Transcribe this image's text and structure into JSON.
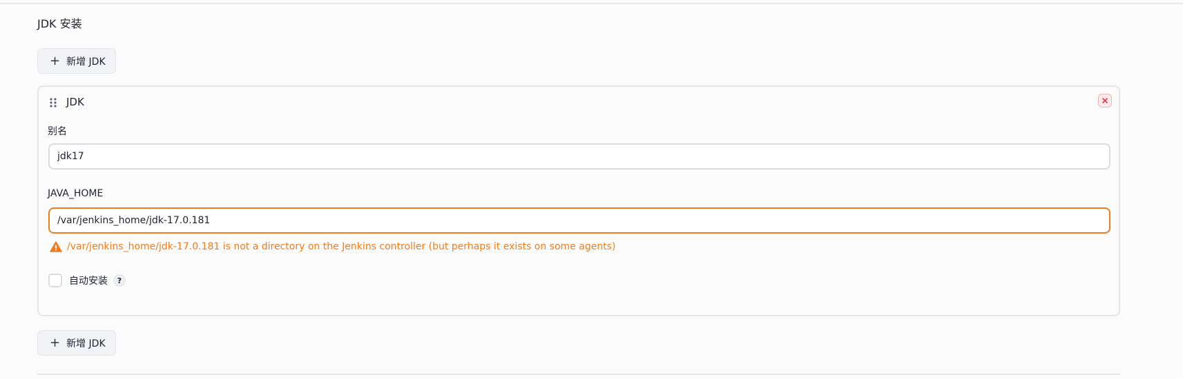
{
  "section": {
    "title": "JDK 安装"
  },
  "add_button": {
    "label": "新增 JDK",
    "icon": "plus-icon"
  },
  "jdk_card": {
    "title": "JDK",
    "drag_icon": "drag-handle-icon",
    "close_icon": "close-icon",
    "alias": {
      "label": "别名",
      "value": "jdk17"
    },
    "java_home": {
      "label": "JAVA_HOME",
      "value": "/var/jenkins_home/jdk-17.0.181",
      "warning": "/var/jenkins_home/jdk-17.0.181 is not a directory on the Jenkins controller (but perhaps it exists on some agents)"
    },
    "auto_install": {
      "label": "自动安装",
      "checked": false,
      "help": "?"
    }
  },
  "colors": {
    "warning": "#f07d1c",
    "close_red": "#e0384a",
    "border": "#e3e6ec"
  }
}
